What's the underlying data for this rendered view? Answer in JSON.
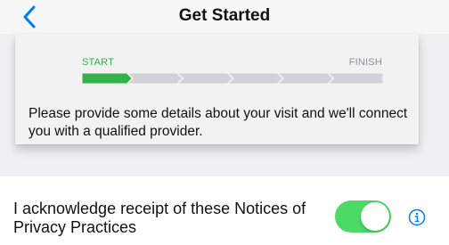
{
  "nav": {
    "title": "Get Started",
    "back_icon": "chevron-left-icon"
  },
  "progress": {
    "start_label": "START",
    "finish_label": "FINISH",
    "total_steps": 6,
    "completed_steps": 1
  },
  "intro": {
    "description": "Please provide some details about your visit and we'll connect you with a qualified provider."
  },
  "acknowledgement": {
    "label": "I acknowledge receipt of these Notices of Privacy Practices",
    "toggle_on": true,
    "info_icon": "info-icon"
  },
  "colors": {
    "accent_blue": "#007aff",
    "progress_green": "#34b24a",
    "toggle_green": "#4cd964",
    "inactive_gray": "#d1d1d6"
  }
}
